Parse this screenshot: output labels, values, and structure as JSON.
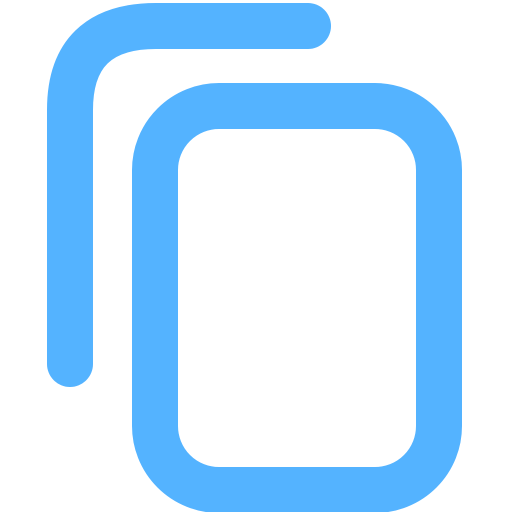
{
  "icon": {
    "name": "copy-icon",
    "color": "#54B3FF",
    "background": "#FFFFFF"
  }
}
